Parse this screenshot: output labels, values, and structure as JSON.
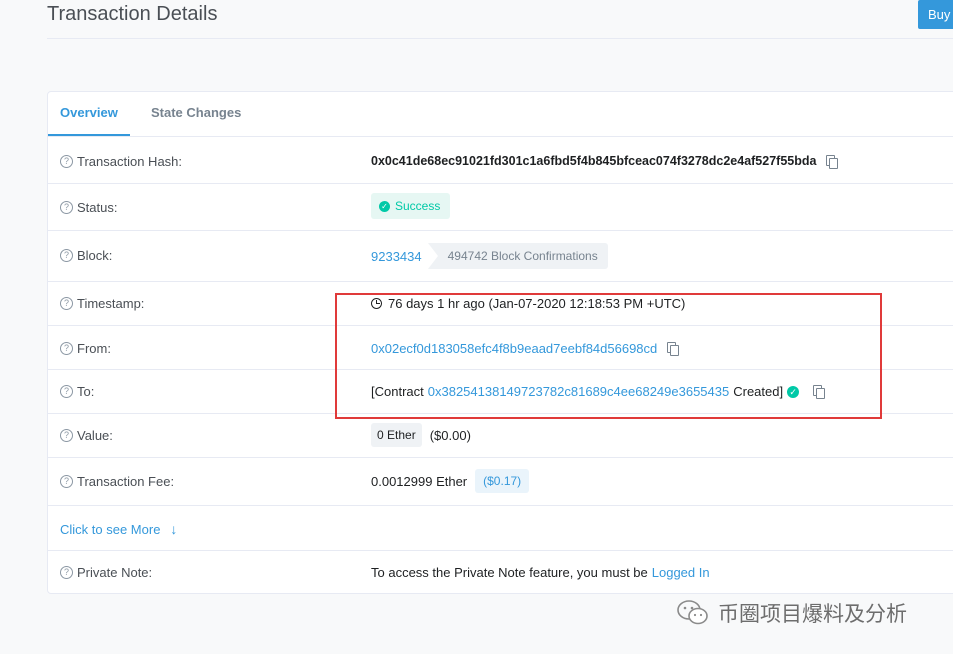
{
  "header": {
    "title": "Transaction Details",
    "buy_label": "Buy"
  },
  "tabs": [
    {
      "label": "Overview",
      "active": true
    },
    {
      "label": "State Changes",
      "active": false
    }
  ],
  "details": {
    "tx_hash": {
      "label": "Transaction Hash:",
      "value": "0x0c41de68ec91021fd301c1a6fbd5f4b845bfceac074f3278dc2e4af527f55bda"
    },
    "status": {
      "label": "Status:",
      "value": "Success"
    },
    "block": {
      "label": "Block:",
      "value": "9233434",
      "confirmations": "494742 Block Confirmations"
    },
    "timestamp": {
      "label": "Timestamp:",
      "value": "76 days 1 hr ago (Jan-07-2020 12:18:53 PM +UTC)"
    },
    "from": {
      "label": "From:",
      "value": "0x02ecf0d183058efc4f8b9eaad7eebf84d56698cd"
    },
    "to": {
      "label": "To:",
      "prefix": "[Contract",
      "address": "0x38254138149723782c81689c4ee68249e3655435",
      "suffix": "Created]"
    },
    "value": {
      "label": "Value:",
      "ether": "0 Ether",
      "usd": "($0.00)"
    },
    "fee": {
      "label": "Transaction Fee:",
      "ether": "0.0012999 Ether",
      "usd": "($0.17)"
    },
    "more": {
      "label": "Click to see More"
    },
    "private_note": {
      "label": "Private Note:",
      "text": "To access the Private Note feature, you must be",
      "link": "Logged In"
    }
  },
  "watermark": {
    "text": "币圈项目爆料及分析"
  },
  "colors": {
    "accent": "#3498db",
    "success": "#00c9a7",
    "highlight": "#e03a3a"
  }
}
